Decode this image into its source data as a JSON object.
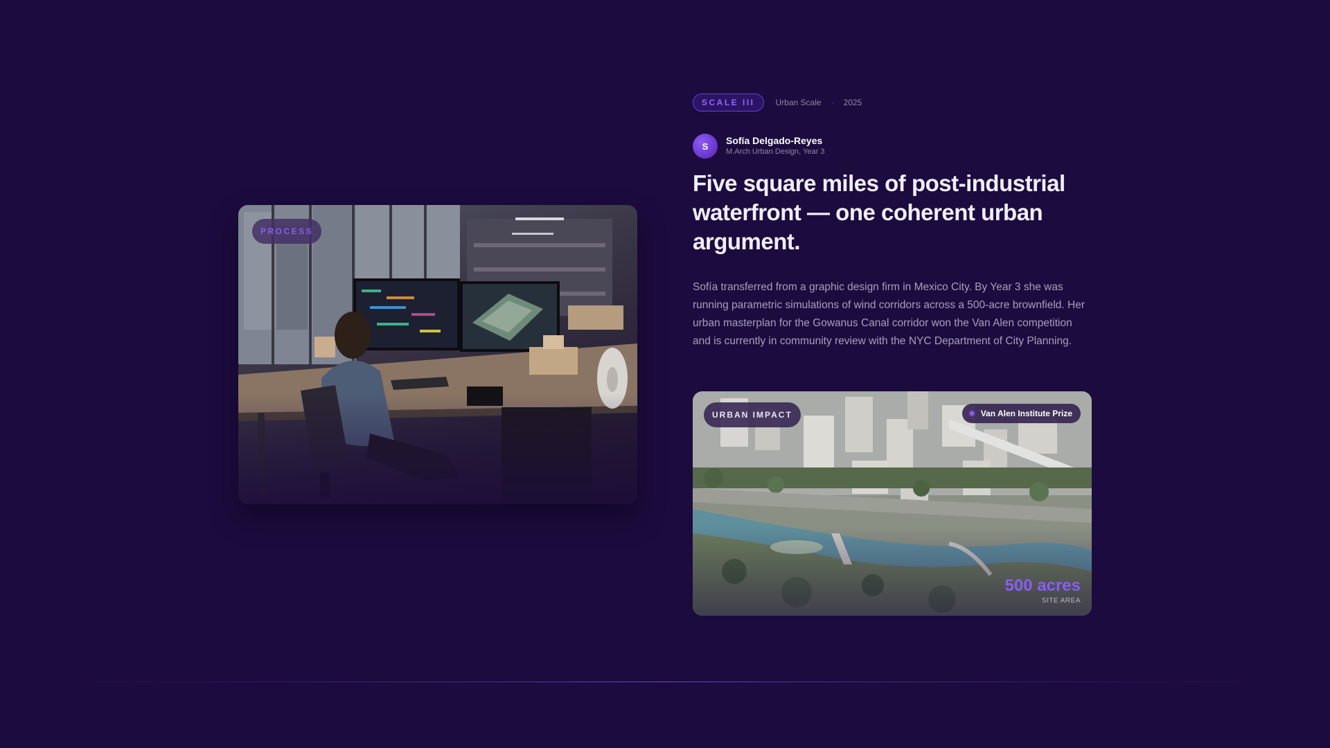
{
  "process_card": {
    "badge": "PROCESS",
    "image": "photo of student working at desk with dual monitors showing urban plans and physical models"
  },
  "meta": {
    "scale_badge": "SCALE III",
    "scale_label": "Urban Scale",
    "separator": "·",
    "year": "2025"
  },
  "author": {
    "initial": "S",
    "name": "Sofía Delgado-Reyes",
    "role": "M.Arch Urban Design, Year 3"
  },
  "headline": "Five square miles of post-industrial waterfront — one coherent urban argument.",
  "body": "Sofía transferred from a graphic design firm in Mexico City. By Year 3 she was running parametric simulations of wind corridors across a 500-acre brownfield. Her urban masterplan for the Gowanus Canal corridor won the Van Alen competition and is currently in community review with the NYC Department of City Planning.",
  "impact_card": {
    "badge": "URBAN IMPACT",
    "prize_icon": "star-icon",
    "prize": "Van Alen Institute Prize",
    "stat_value": "500 acres",
    "stat_label": "SITE AREA",
    "image": "aerial rendering of waterfront masterplan with river, park and mid-rise blocks"
  },
  "colors": {
    "background": "#1c0b3e",
    "accent": "#8b5cf6",
    "accent_bright": "#9565ff"
  }
}
